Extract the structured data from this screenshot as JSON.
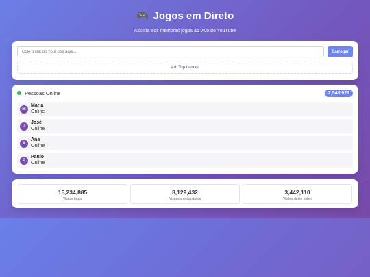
{
  "header": {
    "icon": "gamepad-icon",
    "title": "Jogos em Direto",
    "subtitle": "Assista aos melhores jogos ao vivo do YouTube"
  },
  "loader": {
    "placeholder": "Cole o link do YouTube aqui...",
    "value": "",
    "load_label": "Carregar",
    "ad_label": "Ad: Top banner"
  },
  "online": {
    "label": "Pessoas Online",
    "count": "2,548,921",
    "status_color": "#2fae55",
    "users": [
      {
        "initial": "M",
        "name": "Maria",
        "status": "Online"
      },
      {
        "initial": "J",
        "name": "José",
        "status": "Online"
      },
      {
        "initial": "A",
        "name": "Ana",
        "status": "Online"
      },
      {
        "initial": "P",
        "name": "Paulo",
        "status": "Online"
      }
    ]
  },
  "stats": [
    {
      "value": "15,234,885",
      "label": "Visitas totais"
    },
    {
      "value": "8,129,432",
      "label": "Visitas a esta página"
    },
    {
      "value": "3,442,110",
      "label": "Visitas deste vídeo"
    }
  ],
  "colors": {
    "accent": "#6f86ea",
    "avatar": "#7a4fb0"
  }
}
